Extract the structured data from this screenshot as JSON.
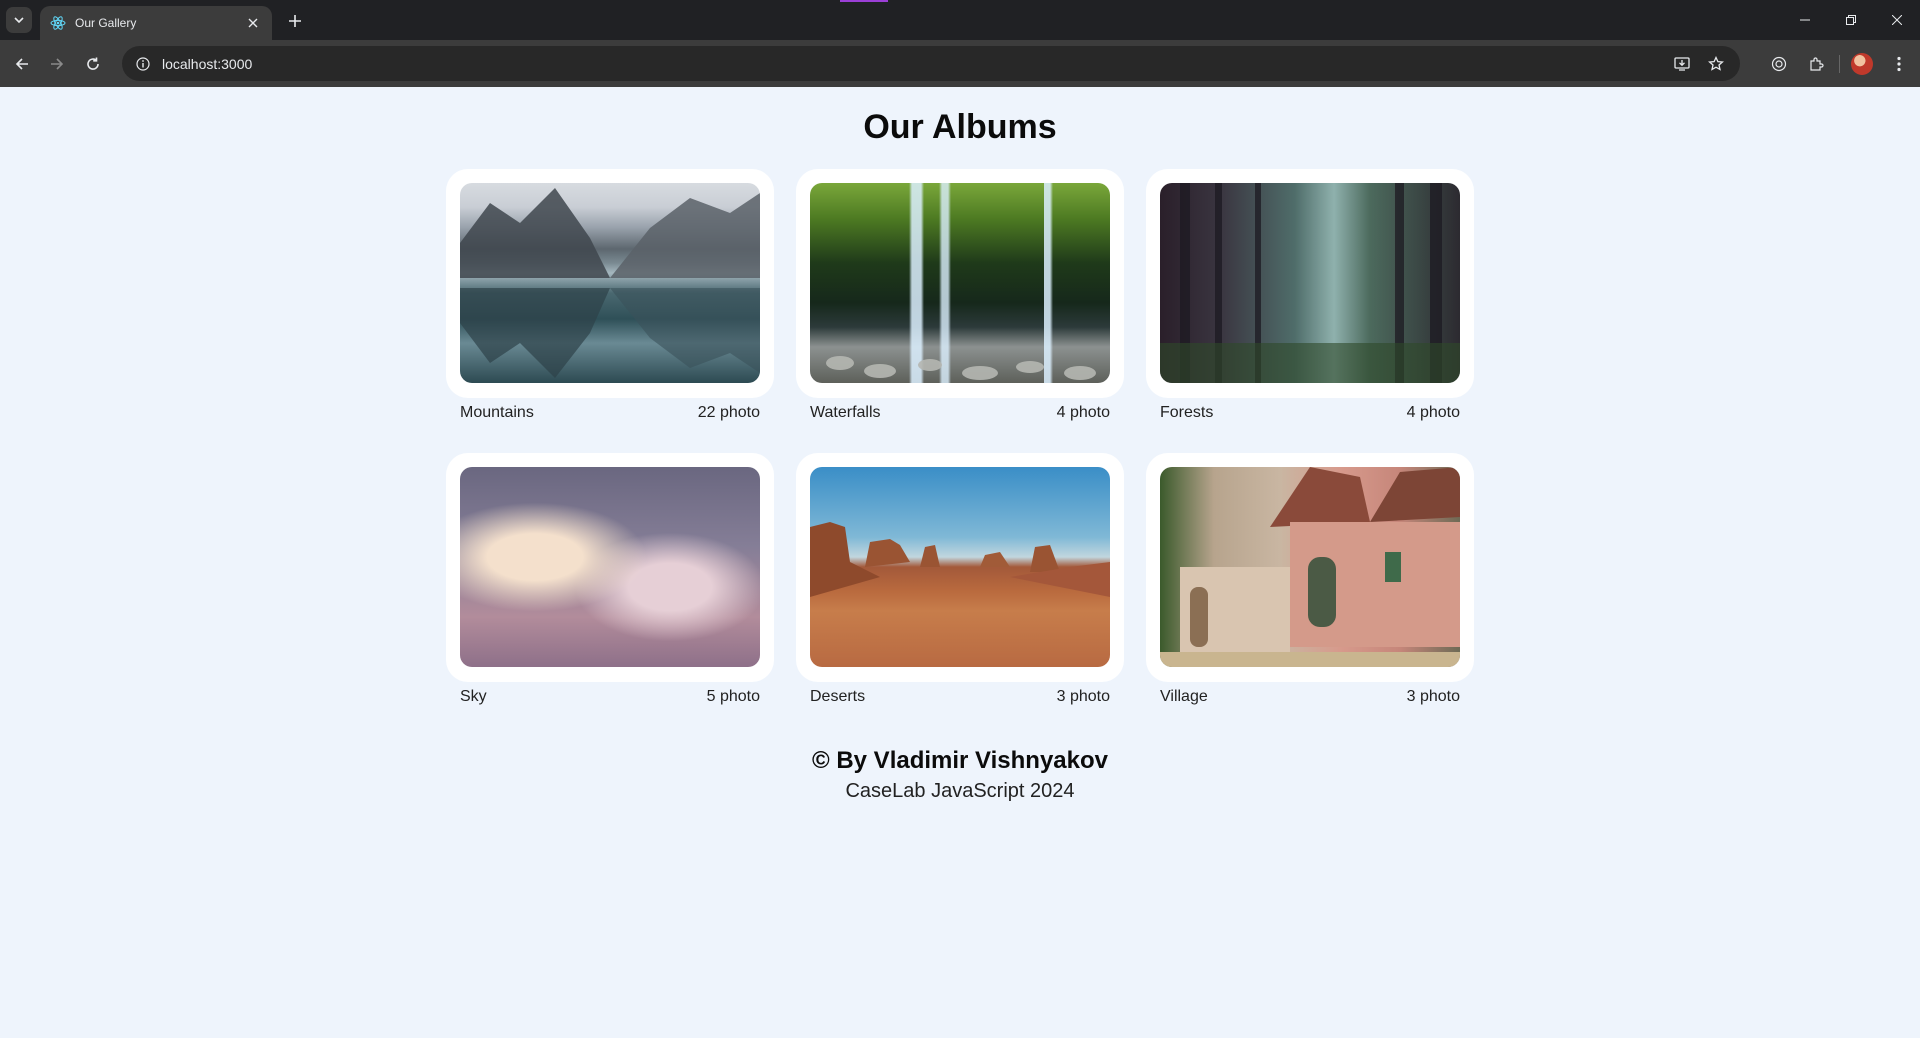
{
  "browser": {
    "tab_title": "Our Gallery",
    "url": "localhost:3000"
  },
  "page": {
    "title": "Our Albums",
    "albums": [
      {
        "name": "Mountains",
        "count": "22 photo",
        "image": "mountain-lake-photo"
      },
      {
        "name": "Waterfalls",
        "count": "4 photo",
        "image": "waterfall-photo"
      },
      {
        "name": "Forests",
        "count": "4 photo",
        "image": "misty-forest-photo"
      },
      {
        "name": "Sky",
        "count": "5 photo",
        "image": "clouds-photo"
      },
      {
        "name": "Deserts",
        "count": "3 photo",
        "image": "desert-buttes-photo"
      },
      {
        "name": "Village",
        "count": "3 photo",
        "image": "village-street-photo"
      }
    ],
    "footer": {
      "author": "© By Vladimir Vishnyakov",
      "course": "CaseLab JavaScript 2024"
    }
  },
  "colors": {
    "page_background": "#eef4fc",
    "card_background": "#ffffff",
    "chrome_dark": "#202124",
    "chrome_toolbar": "#3c3c3c"
  }
}
